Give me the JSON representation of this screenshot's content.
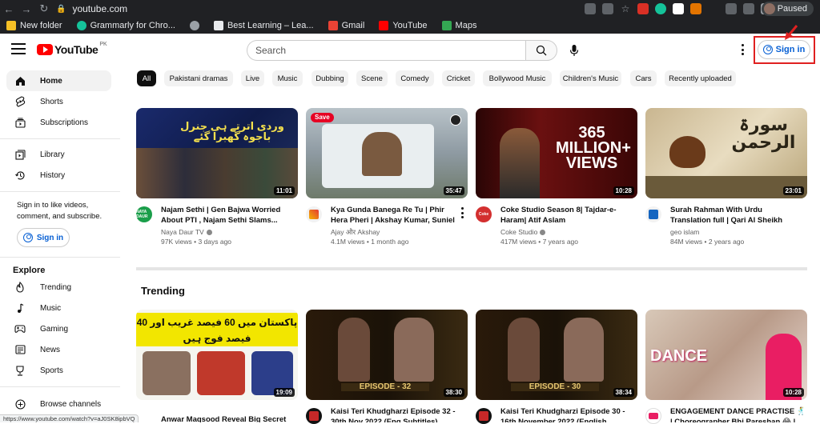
{
  "browser": {
    "url": "youtube.com",
    "profile_status": "Paused",
    "status_url": "https://www.youtube.com/watch?v=aJ0SK8ipbVQ",
    "bookmarks": [
      {
        "label": "New folder",
        "color": "#f6c026"
      },
      {
        "label": "Grammarly for Chro...",
        "color": "#15c39a"
      },
      {
        "label": "",
        "color": "#9aa0a6"
      },
      {
        "label": "Best Learning – Lea...",
        "color": "#e8eaed"
      },
      {
        "label": "Gmail",
        "color": "#ea4335"
      },
      {
        "label": "YouTube",
        "color": "#ff0000"
      },
      {
        "label": "Maps",
        "color": "#34a853"
      }
    ]
  },
  "header": {
    "logo_text": "YouTube",
    "country_code": "PK",
    "search_placeholder": "Search",
    "sign_in": "Sign in"
  },
  "sidebar": {
    "items": [
      {
        "label": "Home",
        "icon": "home-icon"
      },
      {
        "label": "Shorts",
        "icon": "shorts-icon"
      },
      {
        "label": "Subscriptions",
        "icon": "subscriptions-icon"
      },
      {
        "label": "Library",
        "icon": "library-icon"
      },
      {
        "label": "History",
        "icon": "history-icon"
      }
    ],
    "signin_text": "Sign in to like videos, comment, and subscribe.",
    "sign_in": "Sign in",
    "explore_title": "Explore",
    "explore_items": [
      {
        "label": "Trending",
        "icon": "trending-icon"
      },
      {
        "label": "Music",
        "icon": "music-icon"
      },
      {
        "label": "Gaming",
        "icon": "gaming-icon"
      },
      {
        "label": "News",
        "icon": "news-icon"
      },
      {
        "label": "Sports",
        "icon": "sports-icon"
      }
    ],
    "browse_channels": "Browse channels"
  },
  "chips": [
    "All",
    "Pakistani dramas",
    "Live",
    "Music",
    "Dubbing",
    "Scene",
    "Comedy",
    "Cricket",
    "Bollywood Music",
    "Children's Music",
    "Cars",
    "Recently uploaded"
  ],
  "videos": [
    {
      "title": "Najam Sethi | Gen Bajwa Worried About PTI , Najam Sethi Slams...",
      "channel": "Naya Daur TV",
      "meta": "97K views • 3 days ago",
      "duration": "11:01",
      "avatar": "NAYA DAUR",
      "thumb_text": "وردی اترتے ہی جنرل باجوہ گھبرا گئے"
    },
    {
      "title": "Kya Gunda Banega Re Tu | Phir Hera Pheri | Akshay Kumar, Suniel Shetty,...",
      "channel": "Ajay और Akshay",
      "meta": "4.1M views • 1 month ago",
      "duration": "35:47",
      "avatar": "",
      "thumb_text": "Save"
    },
    {
      "title": "Coke Studio Season 8| Tajdar-e-Haram| Atif Aslam",
      "channel": "Coke Studio",
      "meta": "417M views • 7 years ago",
      "duration": "10:28",
      "avatar": "Coke",
      "thumb_text": "365 MILLION+ VIEWS"
    },
    {
      "title": "Surah Rahman With Urdu Translation full | Qari Al Sheikh Abdul Basit Abdu...",
      "channel": "geo islam",
      "meta": "84M views • 2 years ago",
      "duration": "23:01",
      "avatar": "",
      "thumb_text": "سورۃ الرحمن"
    }
  ],
  "trending_title": "Trending",
  "trending": [
    {
      "title": "Anwar Maqsood Reveal Big Secret In...",
      "duration": "19:09",
      "thumb_text": "پاکستان میں 60 فیصد غریب اور 40 فیصد فوج ہیں"
    },
    {
      "title": "Kaisi Teri Khudgharzi Episode 32 - 30th Nov 2022 (Eng Subtitles) ARY...",
      "duration": "38:30",
      "thumb_text": "EPISODE - 32"
    },
    {
      "title": "Kaisi Teri Khudgharzi Episode 30 - 16th November 2022 (English...",
      "duration": "38:34",
      "thumb_text": "EPISODE - 30"
    },
    {
      "title": "ENGAGEMENT DANCE PRACTISE 🕺 | Choreographer Bhi Pareshan 😂 |...",
      "duration": "10:28",
      "thumb_text": "DANCE"
    }
  ]
}
